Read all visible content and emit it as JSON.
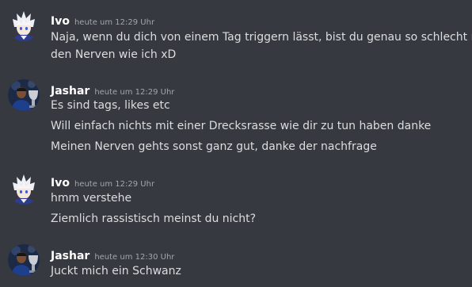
{
  "messages": [
    {
      "author": "Ivo",
      "timestamp": "heute um 12:29 Uhr",
      "avatar_icon": "white-haired-anime-character-avatar",
      "lines": [
        "Naja, wenn du dich von einem Tag triggern lässt, bist du genau so schlecht mit",
        "den Nerven wie ich xD"
      ]
    },
    {
      "author": "Jashar",
      "timestamp": "heute um 12:29 Uhr",
      "avatar_icon": "soccer-player-trophy-avatar",
      "lines": [
        "Es sind tags, likes etc",
        "Will einfach nichts mit einer Drecksrasse wie dir zu tun haben danke",
        "Meinen Nerven gehts sonst ganz gut, danke der nachfrage"
      ]
    },
    {
      "author": "Ivo",
      "timestamp": "heute um 12:29 Uhr",
      "avatar_icon": "white-haired-anime-character-avatar",
      "lines": [
        "hmm verstehe",
        "Ziemlich rassistisch meinst du nicht?"
      ]
    },
    {
      "author": "Jashar",
      "timestamp": "heute um 12:30 Uhr",
      "avatar_icon": "soccer-player-trophy-avatar",
      "lines": [
        "Juckt mich ein Schwanz"
      ]
    }
  ],
  "colors": {
    "background": "#36393f",
    "username": "#ffffff",
    "timestamp": "#a3a6aa",
    "message_text": "#dcddde"
  }
}
